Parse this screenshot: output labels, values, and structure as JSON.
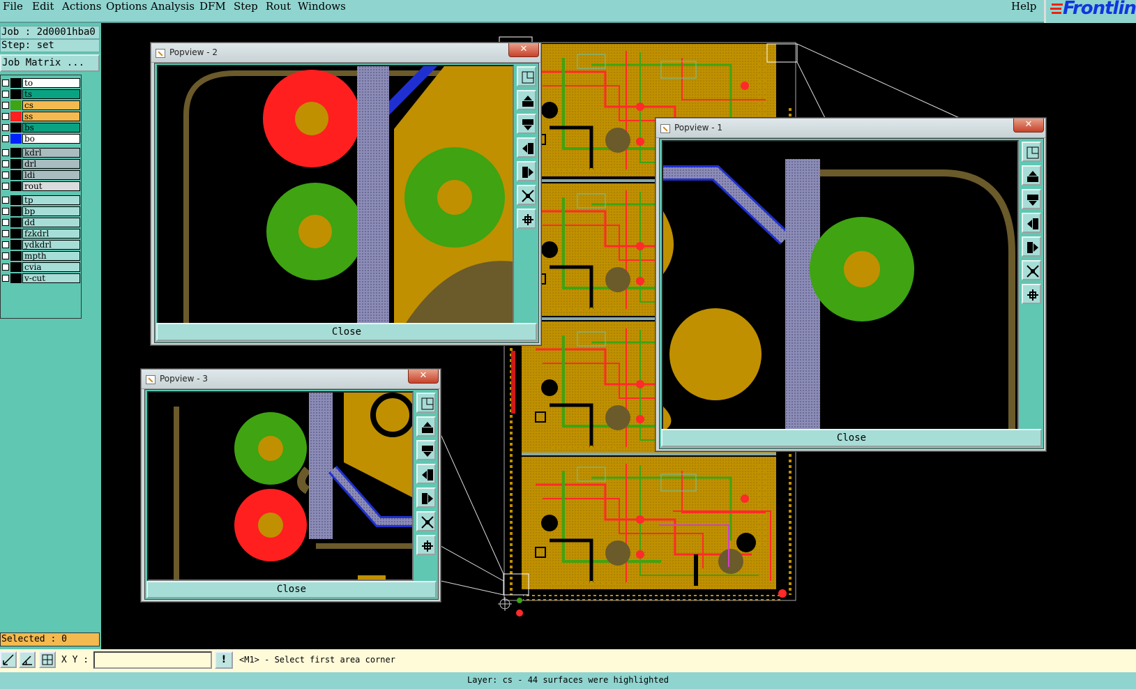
{
  "menubar": {
    "items": [
      "File",
      "Edit",
      "Actions",
      "Options",
      "Analysis",
      "DFM",
      "Step",
      "Rout",
      "Windows"
    ],
    "help": "Help",
    "logo_text": "Frontline"
  },
  "leftpanel": {
    "job": "Job : 2d0001hba0",
    "step": "Step: set",
    "job_matrix": "Job Matrix ...",
    "selected": "Selected : 0",
    "layers": [
      {
        "name": "to",
        "swatch": "#000000",
        "bg": "#ffffff"
      },
      {
        "name": "ts",
        "swatch": "#000000",
        "bg": "#0aa382"
      },
      {
        "name": "cs",
        "swatch": "#3fa312",
        "bg": "#f4b94f"
      },
      {
        "name": "ss",
        "swatch": "#ff1f1f",
        "bg": "#f4b94f"
      },
      {
        "name": "bs",
        "swatch": "#000000",
        "bg": "#0aa382"
      },
      {
        "name": "bo",
        "swatch": "#0022ff",
        "bg": "#ffffff"
      },
      {
        "name": "kdrl",
        "swatch": "#000000",
        "bg": "#a9bcbf"
      },
      {
        "name": "drl",
        "swatch": "#000000",
        "bg": "#a9bcbf"
      },
      {
        "name": "ldi",
        "swatch": "#000000",
        "bg": "#a9bcbf"
      },
      {
        "name": "rout",
        "swatch": "#000000",
        "bg": "#d8dcdc"
      },
      {
        "name": "tp",
        "swatch": "#000000",
        "bg": "#a7ddd7"
      },
      {
        "name": "bp",
        "swatch": "#000000",
        "bg": "#a7ddd7"
      },
      {
        "name": "dd",
        "swatch": "#000000",
        "bg": "#a7ddd7"
      },
      {
        "name": "fzkdrl",
        "swatch": "#000000",
        "bg": "#a7ddd7"
      },
      {
        "name": "ydkdrl",
        "swatch": "#000000",
        "bg": "#a7ddd7"
      },
      {
        "name": "mpth",
        "swatch": "#000000",
        "bg": "#a7ddd7"
      },
      {
        "name": "cvia",
        "swatch": "#000000",
        "bg": "#a7ddd7"
      },
      {
        "name": "v-cut",
        "swatch": "#000000",
        "bg": "#a7ddd7"
      }
    ]
  },
  "cmdbar": {
    "xy_label": "X Y :",
    "xy_value": "",
    "warn": "!",
    "prompt": "<M1> - Select first area corner"
  },
  "status": "Layer: cs - 44 surfaces were highlighted",
  "popviews": [
    {
      "title": "Popview - 2",
      "close_label": "Close"
    },
    {
      "title": "Popview - 1",
      "close_label": "Close"
    },
    {
      "title": "Popview - 3",
      "close_label": "Close"
    }
  ],
  "colors": {
    "copper": "#c09000",
    "pad_green": "#3fa312",
    "pad_red": "#ff1f1f",
    "trace_gray": "#8c8cb8",
    "panel_teal": "#5fc7b2",
    "menubar": "#8fd4cf"
  },
  "icons": [
    "close-icon",
    "zoom-fit-icon",
    "pan-up-icon",
    "pan-down-icon",
    "pan-left-icon",
    "pan-right-icon",
    "zoom-out-icon",
    "zoom-in-icon"
  ]
}
